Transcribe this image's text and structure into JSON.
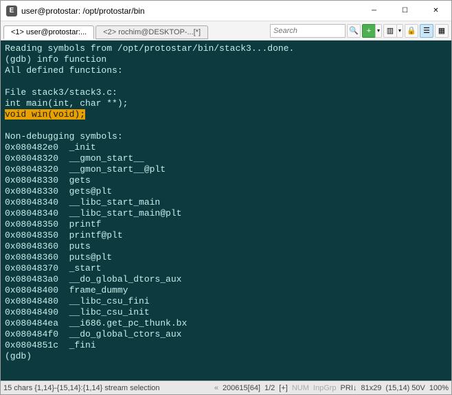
{
  "title": "user@protostar: /opt/protostar/bin",
  "tabs": [
    {
      "label": "<1> user@protostar:...",
      "active": true
    },
    {
      "label": "<2> rochim@DESKTOP-...[*]",
      "active": false
    }
  ],
  "search": {
    "placeholder": "Search"
  },
  "terminal": {
    "pre_highlight": "Reading symbols from /opt/protostar/bin/stack3...done.\n(gdb) info function\nAll defined functions:\n\nFile stack3/stack3.c:\nint main(int, char **);\n",
    "highlight": "void win(void);",
    "post_highlight": "\n\nNon-debugging symbols:\n0x080482e0  _init\n0x08048320  __gmon_start__\n0x08048320  __gmon_start__@plt\n0x08048330  gets\n0x08048330  gets@plt\n0x08048340  __libc_start_main\n0x08048340  __libc_start_main@plt\n0x08048350  printf\n0x08048350  printf@plt\n0x08048360  puts\n0x08048360  puts@plt\n0x08048370  _start\n0x080483a0  __do_global_dtors_aux\n0x08048400  frame_dummy\n0x08048480  __libc_csu_fini\n0x08048490  __libc_csu_init\n0x080484ea  __i686.get_pc_thunk.bx\n0x080484f0  __do_global_ctors_aux\n0x0804851c  _fini\n(gdb) "
  },
  "status": {
    "selection": "15 chars {1,14}-{15,14}:{1,14} stream selection",
    "doc_size": "200615[64]",
    "page": "1/2",
    "modified": "[+]",
    "num": "NUM",
    "inpgrp": "InpGrp",
    "pri": "PRI↓",
    "dims": "81x29",
    "cursor": "(15,14) 50V",
    "zoom": "100%"
  }
}
